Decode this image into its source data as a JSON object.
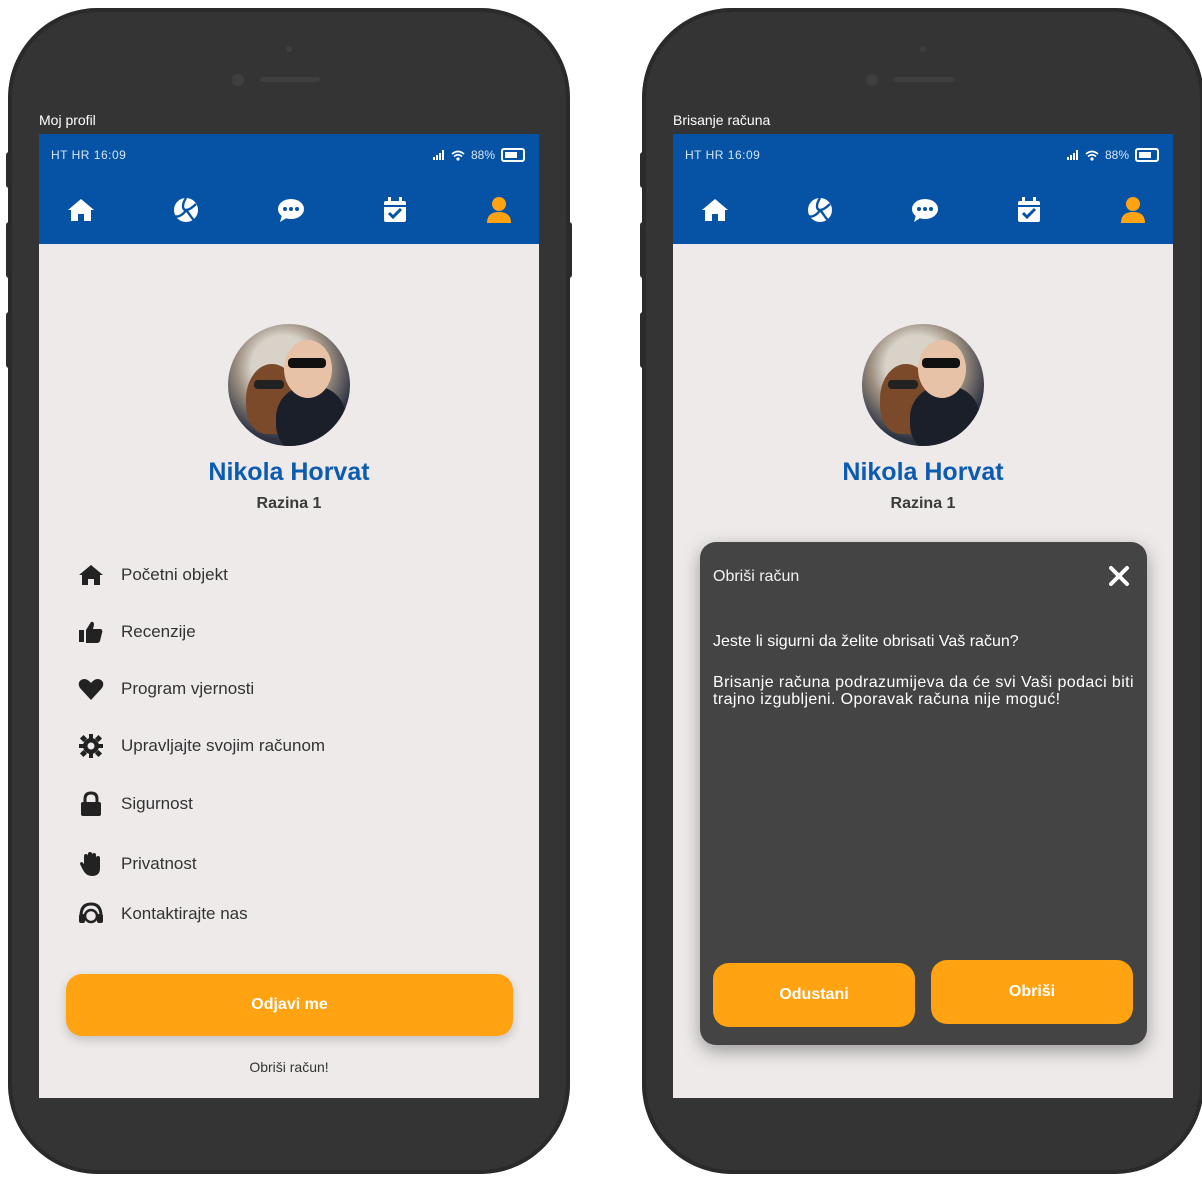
{
  "left": {
    "frame_label": "Moj profil",
    "status": {
      "carrier": "HT HR   16:09",
      "battery": "88%"
    },
    "nav": [
      "home-icon",
      "volleyball-icon",
      "chat-icon",
      "calendar-check-icon",
      "user-icon"
    ],
    "profile": {
      "name": "Nikola Horvat",
      "level": "Razina 1"
    },
    "menu": [
      {
        "icon": "home-icon",
        "label": "Početni objekt"
      },
      {
        "icon": "thumbs-up-icon",
        "label": "Recenzije"
      },
      {
        "icon": "heart-icon",
        "label": "Program vjernosti"
      },
      {
        "icon": "gear-icon",
        "label": "Upravljajte svojim računom"
      },
      {
        "icon": "lock-icon",
        "label": "Sigurnost"
      },
      {
        "icon": "hand-icon",
        "label": "Privatnost"
      },
      {
        "icon": "headset-icon",
        "label": "Kontaktirajte nas"
      }
    ],
    "logout_label": "Odjavi me",
    "delete_link": "Obriši račun!"
  },
  "right": {
    "frame_label": "Brisanje računa",
    "status": {
      "carrier": "HT HR   16:09",
      "battery": "88%"
    },
    "profile": {
      "name": "Nikola Horvat",
      "level": "Razina 1"
    },
    "modal": {
      "title": "Obriši račun",
      "question": "Jeste li sigurni da želite obrisati Vaš račun?",
      "body": "Brisanje računa podrazumijeva da će svi Vaši podaci biti trajno izgubljeni. Oporavak računa nije moguć!",
      "cancel_label": "Odustani",
      "confirm_label": "Obriši"
    }
  },
  "colors": {
    "primary": "#0653a5",
    "accent": "#ffa313",
    "background": "#eeeaea",
    "modal": "#444444"
  }
}
